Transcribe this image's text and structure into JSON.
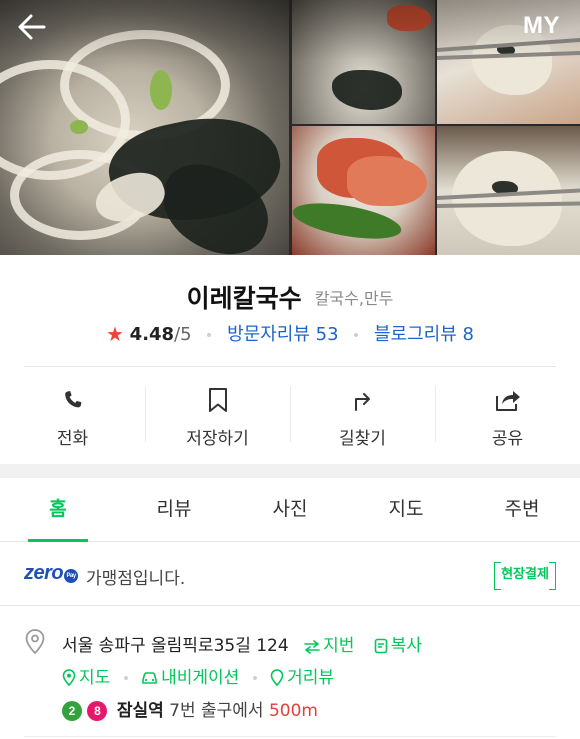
{
  "header": {
    "back_icon": "arrow-left-icon",
    "my_label": "MY",
    "photos": [
      "kalguksu-main-photo",
      "kalguksu-bowl-photo",
      "dumpling-chopsticks-photo",
      "kimchi-side-photo",
      "dumpling-closeup-photo"
    ]
  },
  "place": {
    "name": "이레칼국수",
    "category": "칼국수,만두",
    "rating": "4.48",
    "rating_max": "/5",
    "visitor_reviews": "방문자리뷰 53",
    "blog_reviews": "블로그리뷰 8"
  },
  "actions": [
    {
      "label": "전화",
      "icon": "phone-icon"
    },
    {
      "label": "저장하기",
      "icon": "bookmark-icon"
    },
    {
      "label": "길찾기",
      "icon": "directions-icon"
    },
    {
      "label": "공유",
      "icon": "share-icon"
    }
  ],
  "tabs": [
    {
      "label": "홈",
      "active": true
    },
    {
      "label": "리뷰",
      "active": false
    },
    {
      "label": "사진",
      "active": false
    },
    {
      "label": "지도",
      "active": false
    },
    {
      "label": "주변",
      "active": false
    }
  ],
  "zeropay": {
    "logo": "zero",
    "badge": "Pay",
    "text": "가맹점입니다.",
    "onsite_label": "현장결제"
  },
  "address": {
    "text": "서울 송파구 올림픽로35길 124",
    "jibun_label": "지번",
    "copy_label": "복사",
    "map_label": "지도",
    "navigation_label": "내비게이션",
    "streetview_label": "거리뷰",
    "subway_lines": [
      {
        "number": "2",
        "color": "#33a23d"
      },
      {
        "number": "8",
        "color": "#e6186c"
      }
    ],
    "station": "잠실역",
    "exit_text": "7번 출구에서",
    "distance": "500m"
  },
  "colors": {
    "accent": "#03c75a",
    "link_blue": "#1d65c9",
    "star_red": "#f0443a",
    "distance_red": "#e0413a"
  }
}
